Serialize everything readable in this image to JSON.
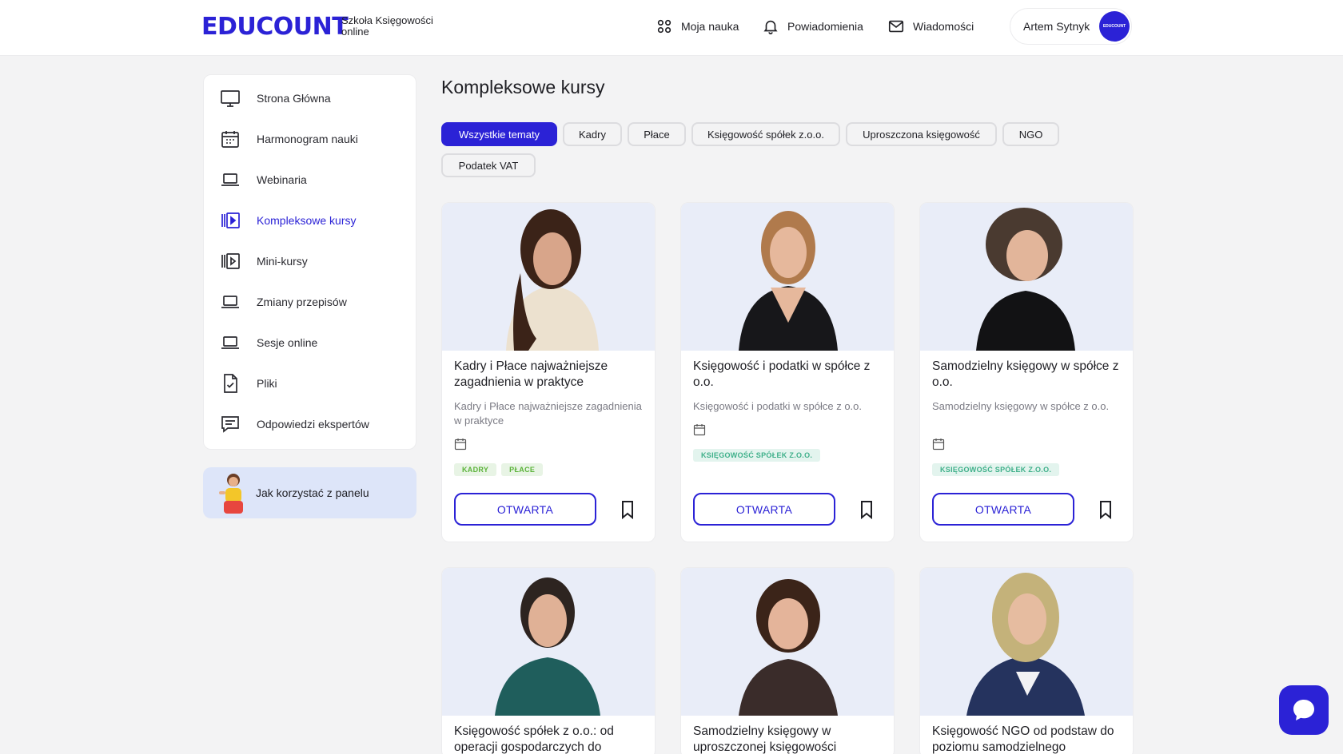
{
  "header": {
    "logo": "EDUCOUNT",
    "logo_sub": "Szkoła Księgowości online",
    "nav": [
      {
        "label": "Moja nauka",
        "icon": "apps-icon"
      },
      {
        "label": "Powiadomienia",
        "icon": "bell-icon"
      },
      {
        "label": "Wiadomości",
        "icon": "mail-icon"
      }
    ],
    "user_name": "Artem Sytnyk",
    "avatar_text": "EDUCOUNT"
  },
  "sidebar": {
    "items": [
      {
        "label": "Strona Główna",
        "icon": "monitor-icon",
        "active": false
      },
      {
        "label": "Harmonogram nauki",
        "icon": "calendar-icon",
        "active": false
      },
      {
        "label": "Webinaria",
        "icon": "laptop-icon",
        "active": false
      },
      {
        "label": "Kompleksowe kursy",
        "icon": "video-library-icon",
        "active": true
      },
      {
        "label": "Mini-kursy",
        "icon": "video-library-icon",
        "active": false
      },
      {
        "label": "Zmiany przepisów",
        "icon": "laptop-icon",
        "active": false
      },
      {
        "label": "Sesje online",
        "icon": "laptop-icon",
        "active": false
      },
      {
        "label": "Pliki",
        "icon": "file-check-icon",
        "active": false
      },
      {
        "label": "Odpowiedzi ekspertów",
        "icon": "chat-icon",
        "active": false
      }
    ],
    "help": "Jak korzystać z panelu"
  },
  "main": {
    "title": "Kompleksowe kursy",
    "filters": [
      "Wszystkie tematy",
      "Kadry",
      "Płace",
      "Księgowość spółek z.o.o.",
      "Uproszczona księgowość",
      "NGO",
      "Podatek VAT"
    ],
    "active_filter": "Wszystkie tematy",
    "cards": [
      {
        "title": "Kadry i Płace najważniejsze zagadnienia w praktyce",
        "subtitle": "Kadry i Płace najważniejsze zagadnienia w praktyce",
        "tags": [
          "KADRY",
          "PŁACE"
        ],
        "button": "OTWARTA"
      },
      {
        "title": "Księgowość i podatki w spółce z o.o.",
        "subtitle": "Księgowość i podatki w spółce z o.o.",
        "tags": [
          "KSIĘGOWOŚĆ SPÓŁEK Z.O.O."
        ],
        "button": "OTWARTA"
      },
      {
        "title": "Samodzielny księgowy w spółce z o.o.",
        "subtitle": "Samodzielny księgowy w spółce z o.o.",
        "tags": [
          "KSIĘGOWOŚĆ SPÓŁEK Z.O.O."
        ],
        "button": "OTWARTA"
      },
      {
        "title": "Księgowość spółek z o.o.: od operacji gospodarczych do",
        "subtitle": "",
        "tags": [],
        "button": ""
      },
      {
        "title": "Samodzielny księgowy w uproszczonej księgowości",
        "subtitle": "",
        "tags": [],
        "button": ""
      },
      {
        "title": "Księgowość NGO od podstaw do poziomu samodzielnego",
        "subtitle": "",
        "tags": [],
        "button": ""
      }
    ]
  },
  "colors": {
    "accent": "#2b22d6",
    "background": "#f3f3f4",
    "help_bg": "#dde5f9"
  }
}
